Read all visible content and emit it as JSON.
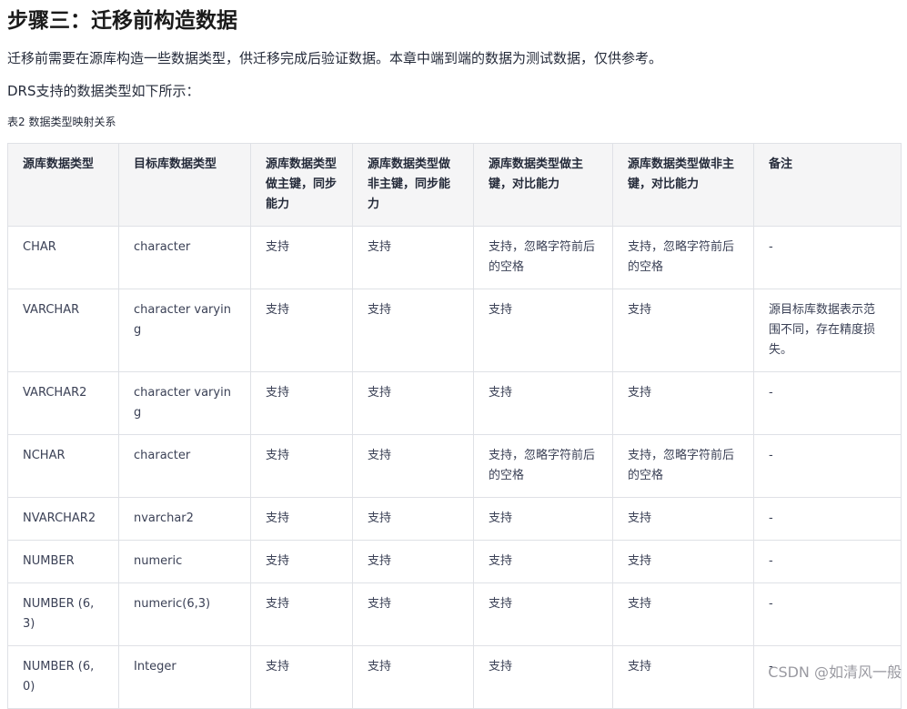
{
  "title": "步骤三：迁移前构造数据",
  "paragraphs": [
    "迁移前需要在源库构造一些数据类型，供迁移完成后验证数据。本章中端到端的数据为测试数据，仅供参考。",
    "DRS支持的数据类型如下所示："
  ],
  "caption": "表2 数据类型映射关系",
  "table": {
    "headers": [
      "源库数据类型",
      "目标库数据类型",
      "源库数据类型做主键，同步能力",
      "源库数据类型做非主键，同步能力",
      "源库数据类型做主键，对比能力",
      "源库数据类型做非主键，对比能力",
      "备注"
    ],
    "rows": [
      [
        "CHAR",
        "character",
        "支持",
        "支持",
        "支持，忽略字符前后的空格",
        "支持，忽略字符前后的空格",
        "-"
      ],
      [
        "VARCHAR",
        "character varying",
        "支持",
        "支持",
        "支持",
        "支持",
        "源目标库数据表示范围不同，存在精度损失。"
      ],
      [
        "VARCHAR2",
        "character varying",
        "支持",
        "支持",
        "支持",
        "支持",
        "-"
      ],
      [
        "NCHAR",
        "character",
        "支持",
        "支持",
        "支持，忽略字符前后的空格",
        "支持，忽略字符前后的空格",
        "-"
      ],
      [
        "NVARCHAR2",
        "nvarchar2",
        "支持",
        "支持",
        "支持",
        "支持",
        "-"
      ],
      [
        "NUMBER",
        "numeric",
        "支持",
        "支持",
        "支持",
        "支持",
        "-"
      ],
      [
        "NUMBER (6,3)",
        "numeric(6,3)",
        "支持",
        "支持",
        "支持",
        "支持",
        "-"
      ],
      [
        "NUMBER (6,0)",
        "Integer",
        "支持",
        "支持",
        "支持",
        "支持",
        "-"
      ]
    ]
  },
  "watermark": "CSDN @如清风一般"
}
